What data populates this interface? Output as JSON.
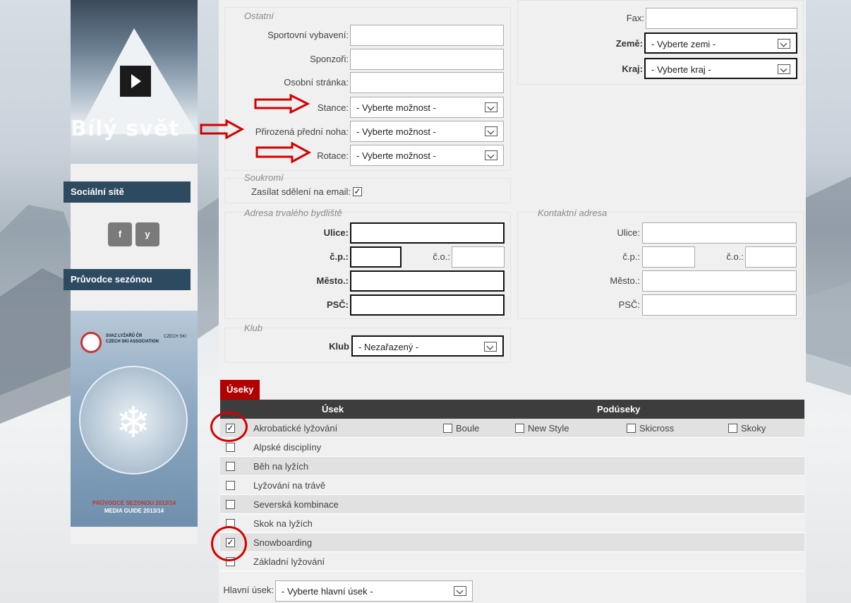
{
  "sidebar": {
    "banner_title": "Bílý svět",
    "social_heading": "Sociální sítě",
    "social_buttons": [
      "f",
      "y"
    ],
    "guide_heading": "Průvodce sezónou",
    "guide": {
      "org_line1": "SVAZ LYŽAŘŮ ČR",
      "org_line2": "CZECH SKI ASSOCIATION",
      "czech_ski": "CZECH SKI",
      "title_line1": "PRŮVODCE SEZONOU 2013/14",
      "title_line2": "MEDIA GUIDE 2013/14"
    }
  },
  "ostatni": {
    "legend": "Ostatní",
    "sportovni_vybaveni": "Sportovní vybavení:",
    "sponzori": "Sponzoři:",
    "osobni_stranka": "Osobní stránka:",
    "stance_label": "Stance:",
    "stance_value": "- Vyberte možnost -",
    "prirozena_label": "Přirozená přední noha:",
    "prirozena_value": "- Vyberte možnost -",
    "rotace_label": "Rotace:",
    "rotace_value": "- Vyberte možnost -"
  },
  "contact_right": {
    "fax_label": "Fax:",
    "zeme_label": "Země:",
    "zeme_value": "- Vyberte zemi -",
    "kraj_label": "Kraj:",
    "kraj_value": "- Vyberte kraj -"
  },
  "soukromi": {
    "legend": "Soukromí",
    "email_label": "Zasílat sdělení na email:",
    "email_checked": true
  },
  "adresa_trvala": {
    "legend": "Adresa trvalého bydliště",
    "ulice": "Ulice:",
    "cp": "č.p.:",
    "co": "č.o.:",
    "mesto": "Město.:",
    "psc": "PSČ:"
  },
  "adresa_kontaktni": {
    "legend": "Kontaktní adresa",
    "ulice": "Ulice:",
    "cp": "č.p.:",
    "co": "č.o.:",
    "mesto": "Město.:",
    "psc": "PSČ:"
  },
  "klub": {
    "legend": "Klub",
    "label": "Klub",
    "value": "- Nezařazený -"
  },
  "useky": {
    "tab": "Úseky",
    "col_usek": "Úsek",
    "col_poduseky": "Podúseky",
    "rows": [
      {
        "name": "Akrobatické lyžování",
        "checked": true
      },
      {
        "name": "Alpské disciplíny",
        "checked": false
      },
      {
        "name": "Běh na lyžích",
        "checked": false
      },
      {
        "name": "Lyžování na trávě",
        "checked": false
      },
      {
        "name": "Severská kombinace",
        "checked": false
      },
      {
        "name": "Skok na lyžích",
        "checked": false
      },
      {
        "name": "Snowboarding",
        "checked": true
      },
      {
        "name": "Základní lyžování",
        "checked": false
      }
    ],
    "podseky": [
      "Boule",
      "New Style",
      "Skicross",
      "Skoky"
    ]
  },
  "hlavni_usek": {
    "label": "Hlavní úsek:",
    "value": "- Vyberte hlavní úsek -"
  },
  "colors": {
    "accent": "#b30000",
    "sidebar_heading": "#2d4a60",
    "annotation": "#d40000",
    "table_header": "#3d3d3d"
  }
}
